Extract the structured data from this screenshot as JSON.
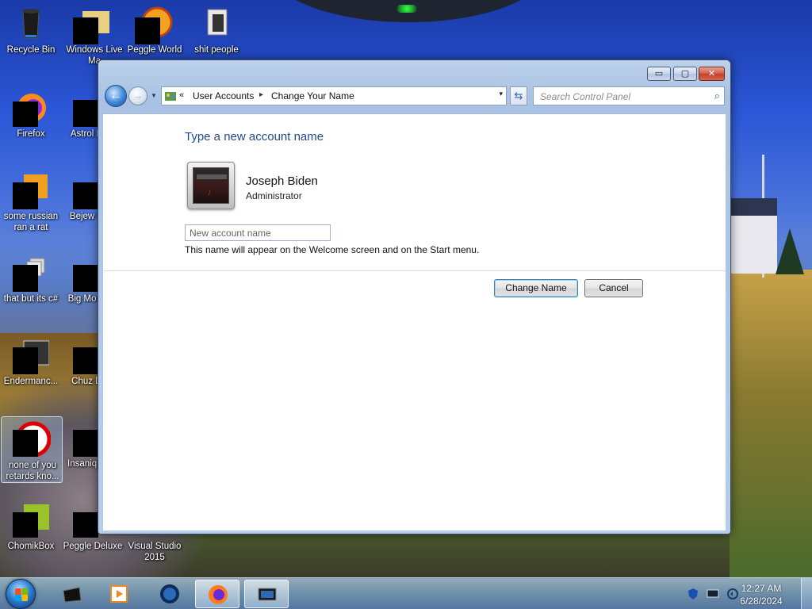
{
  "desktop": {
    "icons": [
      {
        "label": "Recycle Bin"
      },
      {
        "label": "Windows Live Ma"
      },
      {
        "label": "Peggle World"
      },
      {
        "label": "shit people"
      },
      {
        "label": "Firefox"
      },
      {
        "label": "Astrol Delu"
      },
      {
        "label": "some russian ran a rat"
      },
      {
        "label": "Bejew Delu"
      },
      {
        "label": "that but its c#"
      },
      {
        "label": "Big Mo Delu"
      },
      {
        "label": "Endermanc..."
      },
      {
        "label": "Chuz Delu"
      },
      {
        "label": "none of you retards kno..."
      },
      {
        "label": "Insaniq Delu"
      },
      {
        "label": "ChomikBox"
      },
      {
        "label": "Peggle Deluxe"
      },
      {
        "label": "Visual Studio 2015"
      }
    ]
  },
  "window": {
    "controls": {
      "minimize": "▭",
      "maximize": "▢",
      "close": "✕"
    },
    "address": {
      "prefix": "«",
      "crumbs": [
        "User Accounts",
        "Change Your Name"
      ],
      "separator": "▸",
      "dropdown": "▾"
    },
    "search": {
      "placeholder": "Search Control Panel",
      "icon": "magnifier-icon"
    },
    "content": {
      "heading": "Type a new account name",
      "user_name": "Joseph Biden",
      "user_role": "Administrator",
      "input_placeholder": "New account name",
      "input_value": "",
      "hint": "This name will appear on the Welcome screen and on the Start menu.",
      "change_button": "Change Name",
      "cancel_button": "Cancel"
    }
  },
  "taskbar": {
    "pinned": [
      "taskbar-app-1",
      "media-player",
      "browser-globe",
      "firefox",
      "remote-desktop"
    ],
    "active_index": 3,
    "clock": {
      "time": "12:27 AM",
      "date": "6/28/2024"
    }
  },
  "colors": {
    "heading": "#1e4a8c",
    "accent": "#3c7fb1",
    "taskbar": "#7aa0c8"
  }
}
